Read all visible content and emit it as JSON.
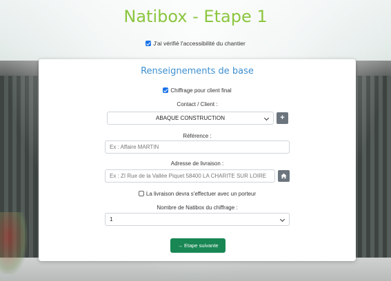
{
  "page": {
    "title": "Natibox - Etape 1",
    "accessibility_check": {
      "label": "J'ai vérifié l'accessibilité du chantier",
      "checked": true
    }
  },
  "card": {
    "title": "Renseignements de base",
    "final_client_check": {
      "label": "Chiffrage pour client final",
      "checked": true
    },
    "contact": {
      "label": "Contact / Client :",
      "value": "ABAQUE CONSTRUCTION",
      "add_icon": "plus-icon"
    },
    "reference": {
      "label": "Référence :",
      "placeholder": "Ex : Affaire MARTIN"
    },
    "address": {
      "label": "Adresse de livraison :",
      "placeholder": "Ex : ZI Rue de la Vallée Piquet 58400 LA CHARITE SUR LOIRE",
      "home_icon": "home-icon"
    },
    "porter_check": {
      "label": "La livraison devra s'effectuer avec un porteur",
      "checked": false
    },
    "quantity": {
      "label": "Nombre de Natibox du chiffrage :",
      "value": "1"
    },
    "next_button": {
      "arrow": "→",
      "label": "Etape suivante"
    }
  },
  "colors": {
    "title_green": "#8cc63f",
    "card_title_blue": "#3d8fcf",
    "button_green": "#198754",
    "icon_button_gray": "#6c757d"
  }
}
